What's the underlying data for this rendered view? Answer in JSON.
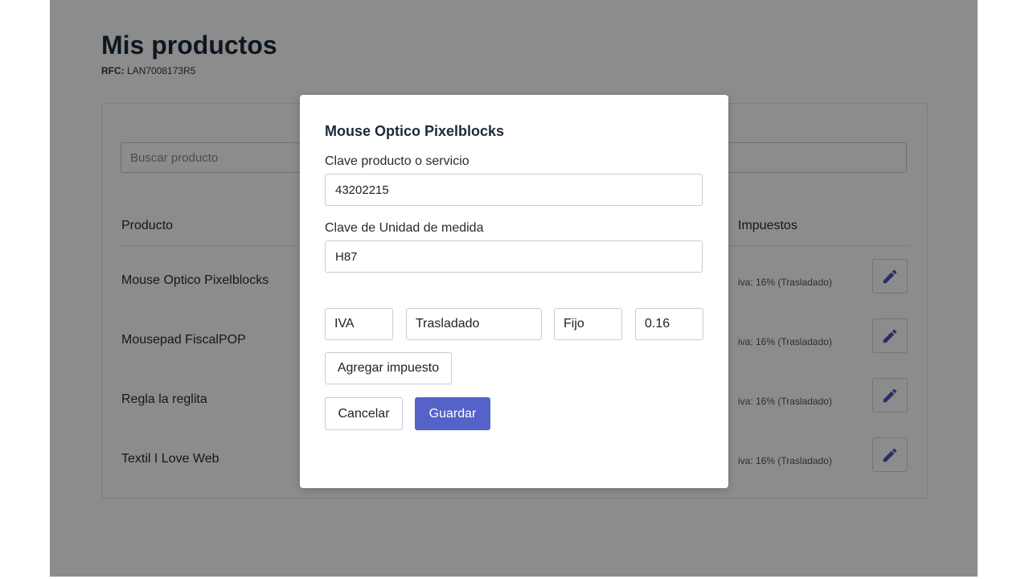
{
  "page": {
    "title": "Mis productos",
    "rfc_label": "RFC:",
    "rfc_value": "LAN7008173R5"
  },
  "search": {
    "placeholder": "Buscar producto",
    "value": ""
  },
  "table": {
    "headers": {
      "product": "Producto",
      "taxes": "Impuestos"
    },
    "rows": [
      {
        "name": "Mouse Optico Pixelblocks",
        "taxes": "iva: 16% (Trasladado)"
      },
      {
        "name": "Mousepad FiscalPOP",
        "taxes": "iva: 16% (Trasladado)"
      },
      {
        "name": "Regla la reglita",
        "taxes": "iva: 16% (Trasladado)"
      },
      {
        "name": "Textil I Love Web",
        "taxes": "iva: 16% (Trasladado)"
      }
    ],
    "edit_icon": "pencil-icon"
  },
  "modal": {
    "title": "Mouse Optico Pixelblocks",
    "product_key_label": "Clave producto o servicio",
    "product_key_value": "43202215",
    "unit_key_label": "Clave de Unidad de medida",
    "unit_key_value": "H87",
    "tax": {
      "type": "IVA",
      "kind": "Trasladado",
      "factor": "Fijo",
      "rate": "0.16"
    },
    "add_tax_label": "Agregar impuesto",
    "cancel_label": "Cancelar",
    "save_label": "Guardar"
  },
  "colors": {
    "accent": "#5562c7",
    "overlay": "rgba(0,0,0,0.45)"
  }
}
